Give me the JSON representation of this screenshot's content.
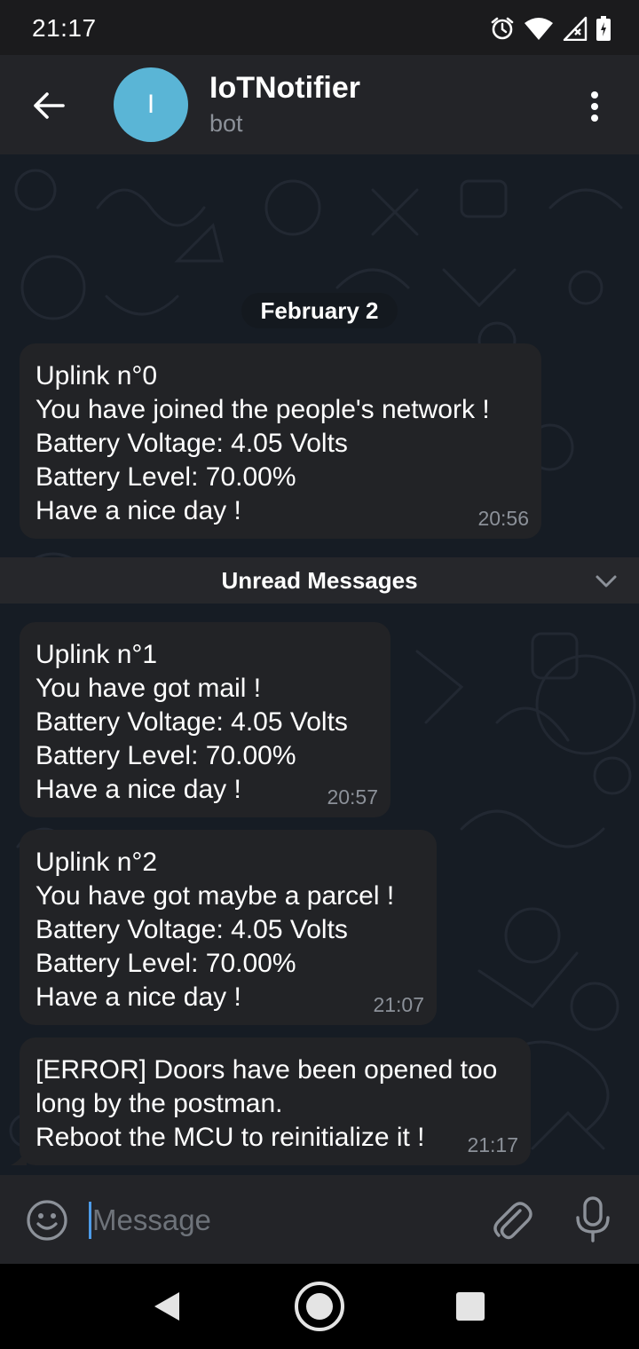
{
  "status_bar": {
    "time": "21:17",
    "icons": [
      "alarm-icon",
      "wifi-icon",
      "signal-icon",
      "battery-icon"
    ]
  },
  "header": {
    "avatar_letter": "I",
    "title": "IoTNotifier",
    "subtitle": "bot",
    "avatar_color": "#5ab5d6"
  },
  "chat": {
    "date_chip": "February 2",
    "unread_label": "Unread Messages",
    "messages": [
      {
        "lines": [
          "Uplink n°0",
          "You have joined the people's network !",
          "Battery Voltage: 4.05 Volts",
          "Battery Level: 70.00%",
          "Have a nice day !"
        ],
        "time": "20:56"
      },
      {
        "lines": [
          "Uplink n°1",
          "You have got mail !",
          "Battery Voltage: 4.05 Volts",
          "Battery Level: 70.00%",
          "Have a nice day !"
        ],
        "time": "20:57"
      },
      {
        "lines": [
          "Uplink n°2",
          "You have got maybe a parcel !",
          "Battery Voltage: 4.05 Volts",
          "Battery Level: 70.00%",
          "Have a nice day !"
        ],
        "time": "21:07"
      },
      {
        "lines": [
          "[ERROR] Doors have been opened too",
          "long by the postman.",
          "Reboot the MCU to reinitialize it !"
        ],
        "time": "21:17"
      }
    ]
  },
  "input_bar": {
    "placeholder": "Message"
  },
  "colors": {
    "bubble": "#222326",
    "header": "#232428",
    "accent": "#4d9be8"
  }
}
